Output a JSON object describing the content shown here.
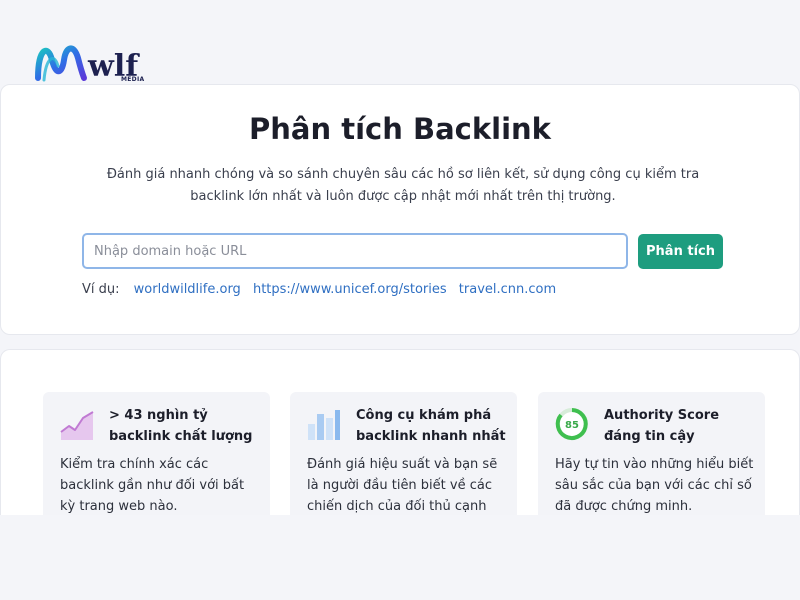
{
  "logo": {
    "subtext": "MEDIA",
    "wordmark": "wlf"
  },
  "hero": {
    "title": "Phân tích Backlink",
    "description": "Đánh giá nhanh chóng và so sánh chuyên sâu các hồ sơ liên kết, sử dụng công cụ kiểm tra backlink lớn nhất và luôn được cập nhật mới nhất trên thị trường.",
    "search_placeholder": "Nhập domain hoặc URL",
    "search_value": "",
    "analyze_label": "Phân tích",
    "examples_label": "Ví dụ:",
    "examples": [
      "worldwildlife.org",
      "https://www.unicef.org/stories",
      "travel.cnn.com"
    ]
  },
  "features": [
    {
      "icon": "growth-chart-icon",
      "title": "> 43 nghìn tỷ backlink chất lượng",
      "text": "Kiểm tra chính xác các backlink gần như đối với bất kỳ trang web nào."
    },
    {
      "icon": "bar-chart-icon",
      "title": "Công cụ khám phá backlink nhanh nhất",
      "text": "Đánh giá hiệu suất và bạn sẽ là người đầu tiên biết về các chiến dịch của đối thủ cạnh"
    },
    {
      "icon": "authority-score-gauge-icon",
      "gauge_value": "85",
      "title": "Authority Score đáng tin cậy",
      "text": "Hãy tự tin vào những hiểu biết sâu sắc của bạn với các chỉ số đã được chứng minh."
    }
  ],
  "colors": {
    "primary_button": "#1e9d7f",
    "link": "#2f6fc2",
    "input_border": "#8fb6e8",
    "page_bg": "#f4f5f9"
  }
}
